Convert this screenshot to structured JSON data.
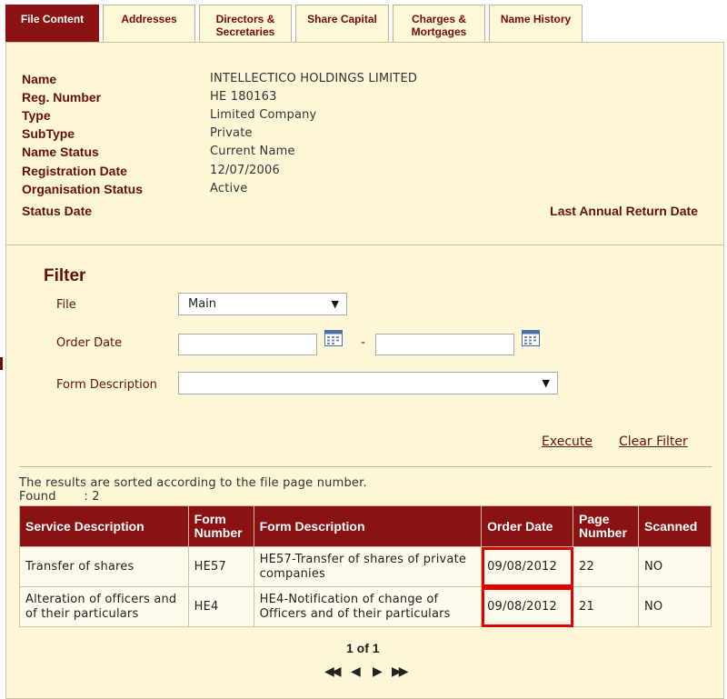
{
  "tabs": [
    {
      "label": "File Content",
      "active": true
    },
    {
      "label": "Addresses",
      "active": false
    },
    {
      "label": "Directors & Secretaries",
      "active": false
    },
    {
      "label": "Share Capital",
      "active": false
    },
    {
      "label": "Charges & Mortgages",
      "active": false
    },
    {
      "label": "Name History",
      "active": false
    }
  ],
  "company": {
    "name_label": "Name",
    "name": "INTELLECTICO HOLDINGS LIMITED",
    "reg_label": "Reg. Number",
    "reg": "HE 180163",
    "type_label": "Type",
    "type": "Limited Company",
    "subtype_label": "SubType",
    "subtype": "Private",
    "name_status_label": "Name Status",
    "name_status": "Current Name",
    "reg_date_label": "Registration Date",
    "reg_date": "12/07/2006",
    "org_status_label": "Organisation Status",
    "org_status": "Active",
    "status_date_label": "Status Date",
    "last_annual_label": "Last Annual Return Date"
  },
  "filter": {
    "title": "Filter",
    "file_label": "File",
    "file_value": "Main",
    "order_date_label": "Order Date",
    "date_separator": "-",
    "form_desc_label": "Form Description",
    "form_desc_value": "",
    "execute_label": "Execute",
    "clear_label": "Clear Filter"
  },
  "results": {
    "sorted_note": "The results are sorted according to the file page number.",
    "found_label": "Found",
    "found_sep": ": 2",
    "headers": [
      "Service Description",
      "Form Number",
      "Form Description",
      "Order Date",
      "Page Number",
      "Scanned"
    ],
    "rows": [
      {
        "service": "Transfer of shares",
        "form_no": "HE57",
        "form_desc": "HE57-Transfer of shares of private companies",
        "order_date": "09/08/2012",
        "page": "22",
        "scanned": "NO"
      },
      {
        "service": "Alteration of officers and of their particulars",
        "form_no": "HE4",
        "form_desc": "HE4-Notification of change of Officers and of their particulars",
        "order_date": "09/08/2012",
        "page": "21",
        "scanned": "NO"
      }
    ]
  },
  "pager": {
    "text": "1 of 1",
    "first": "◀◀",
    "prev": "◀",
    "next": "▶",
    "last": "▶▶"
  },
  "colors": {
    "brand": "#8a1212",
    "panel": "#fdf7d7",
    "highlight": "#e00000"
  }
}
